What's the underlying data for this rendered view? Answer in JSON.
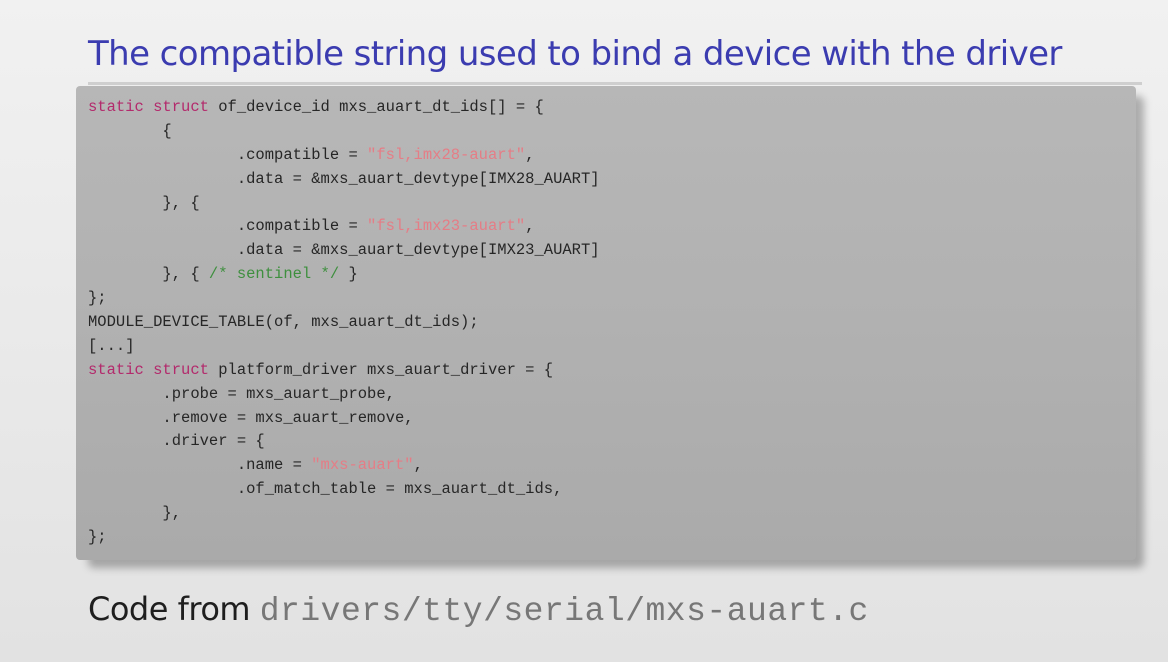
{
  "slide": {
    "title": "The compatible string used to bind a device with the driver"
  },
  "code": {
    "lines": [
      [
        {
          "t": "static struct",
          "c": "kw"
        },
        {
          "t": " of_device_id mxs_auart_dt_ids[] = {",
          "c": ""
        }
      ],
      [
        {
          "t": "        {",
          "c": ""
        }
      ],
      [
        {
          "t": "                .compatible = ",
          "c": ""
        },
        {
          "t": "\"fsl,imx28-auart\"",
          "c": "str"
        },
        {
          "t": ",",
          "c": ""
        }
      ],
      [
        {
          "t": "                .data = &mxs_auart_devtype[IMX28_AUART]",
          "c": ""
        }
      ],
      [
        {
          "t": "        }, {",
          "c": ""
        }
      ],
      [
        {
          "t": "                .compatible = ",
          "c": ""
        },
        {
          "t": "\"fsl,imx23-auart\"",
          "c": "str"
        },
        {
          "t": ",",
          "c": ""
        }
      ],
      [
        {
          "t": "                .data = &mxs_auart_devtype[IMX23_AUART]",
          "c": ""
        }
      ],
      [
        {
          "t": "        }, { ",
          "c": ""
        },
        {
          "t": "/* sentinel */",
          "c": "cmt"
        },
        {
          "t": " }",
          "c": ""
        }
      ],
      [
        {
          "t": "};",
          "c": ""
        }
      ],
      [
        {
          "t": "MODULE_DEVICE_TABLE(of, mxs_auart_dt_ids);",
          "c": ""
        }
      ],
      [
        {
          "t": "[...]",
          "c": ""
        }
      ],
      [
        {
          "t": "static struct",
          "c": "kw"
        },
        {
          "t": " platform_driver mxs_auart_driver = {",
          "c": ""
        }
      ],
      [
        {
          "t": "        .probe = mxs_auart_probe,",
          "c": ""
        }
      ],
      [
        {
          "t": "        .remove = mxs_auart_remove,",
          "c": ""
        }
      ],
      [
        {
          "t": "        .driver = {",
          "c": ""
        }
      ],
      [
        {
          "t": "                .name = ",
          "c": ""
        },
        {
          "t": "\"mxs-auart\"",
          "c": "str"
        },
        {
          "t": ",",
          "c": ""
        }
      ],
      [
        {
          "t": "                .of_match_table = mxs_auart_dt_ids,",
          "c": ""
        }
      ],
      [
        {
          "t": "        },",
          "c": ""
        }
      ],
      [
        {
          "t": "};",
          "c": ""
        }
      ]
    ]
  },
  "caption": {
    "text": "Code from ",
    "path": "drivers/tty/serial/mxs-auart.c"
  },
  "colors": {
    "title": "#3b3cb0",
    "keyword": "#b32a6c",
    "string": "#e57d86",
    "comment": "#3e8f3e"
  }
}
